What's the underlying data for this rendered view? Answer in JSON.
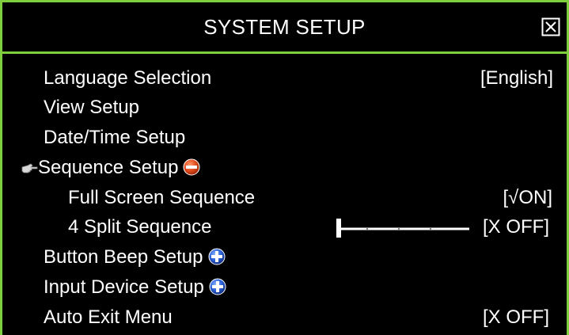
{
  "window": {
    "title": "SYSTEM SETUP"
  },
  "menu": {
    "items": [
      {
        "label": "Language Selection",
        "value": "[English]"
      },
      {
        "label": "View Setup"
      },
      {
        "label": "Date/Time Setup"
      },
      {
        "label": "Sequence Setup",
        "expander": "minus-icon",
        "selected": true
      },
      {
        "label": "Full Screen Sequence",
        "value": "[√ON]"
      },
      {
        "label": "4 Split Sequence",
        "value": "[X OFF]"
      },
      {
        "label": "Button Beep Setup",
        "expander": "plus-icon"
      },
      {
        "label": "Input Device Setup",
        "expander": "plus-icon"
      },
      {
        "label": "Auto Exit Menu",
        "value": "[X OFF]"
      }
    ]
  },
  "colors": {
    "border": "#7fce3d",
    "background": "#000000",
    "text": "#ffffff",
    "minus_icon": "#e0491c",
    "plus_icon": "#2a5fd6"
  }
}
